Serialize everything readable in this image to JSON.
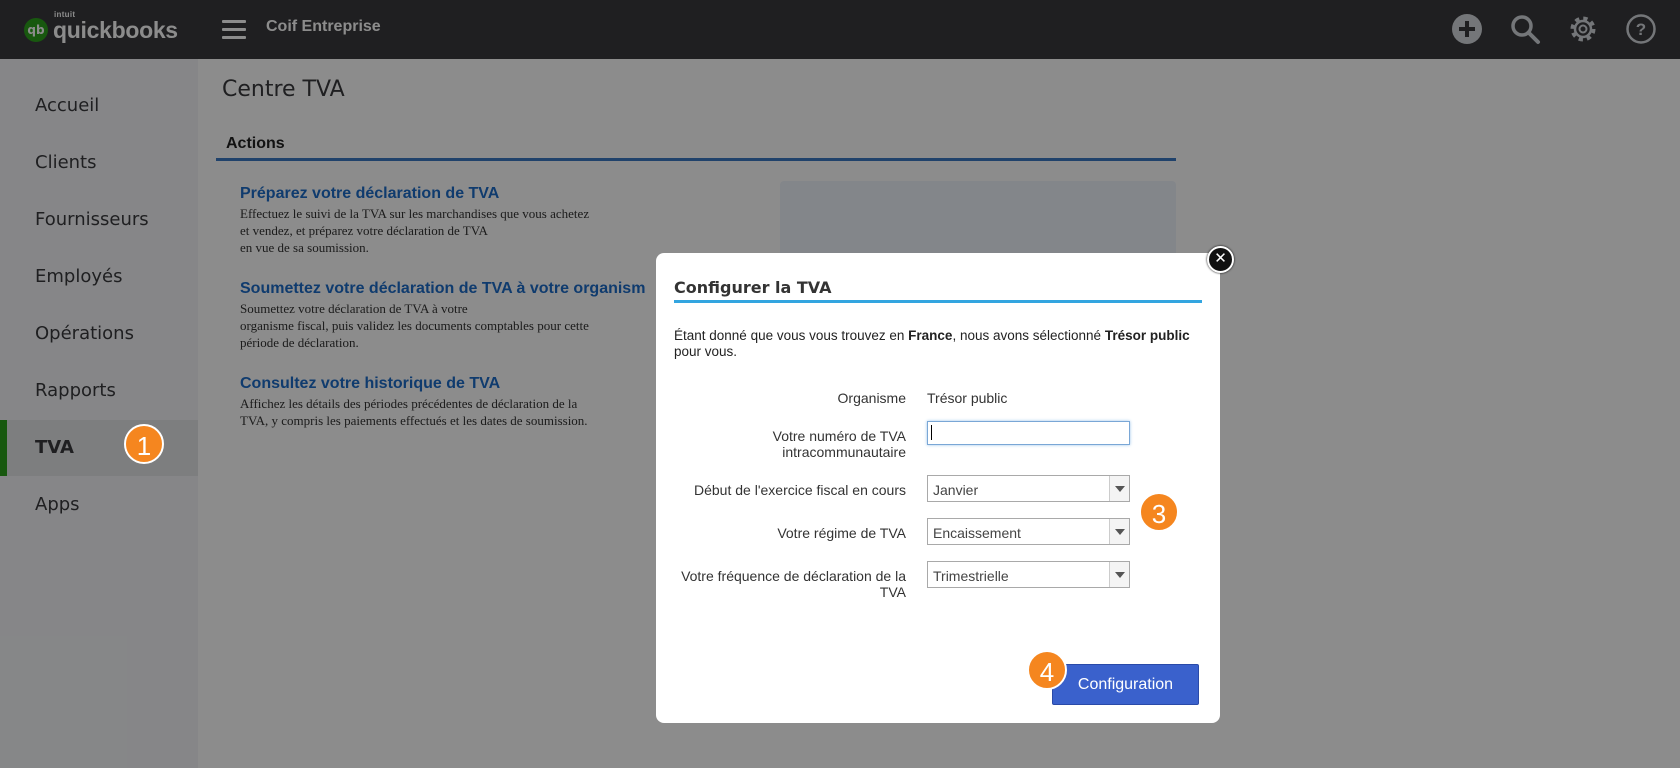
{
  "app": {
    "brand_small": "intuit",
    "brand_name": "quickbooks",
    "logo_mark": "qb",
    "company": "Coif Entreprise"
  },
  "sidebar": {
    "items": [
      {
        "label": "Accueil"
      },
      {
        "label": "Clients"
      },
      {
        "label": "Fournisseurs"
      },
      {
        "label": "Employés"
      },
      {
        "label": "Opérations"
      },
      {
        "label": "Rapports"
      },
      {
        "label": "TVA",
        "active": true
      },
      {
        "label": "Apps"
      }
    ]
  },
  "main": {
    "title": "Centre TVA",
    "section": "Actions",
    "actions": [
      {
        "title": "Préparez votre déclaration de TVA",
        "desc": [
          "Effectuez le suivi de la TVA sur les marchandises que vous achetez",
          "et vendez, et préparez votre déclaration de TVA",
          "en vue de sa soumission."
        ]
      },
      {
        "title": "Soumettez votre déclaration de TVA à votre organism",
        "desc": [
          "Soumettez votre déclaration de TVA à votre",
          "organisme fiscal, puis validez les documents comptables pour cette",
          "période de déclaration."
        ]
      },
      {
        "title": "Consultez votre historique de TVA",
        "desc": [
          "Affichez les détails des périodes précédentes de déclaration de la",
          "TVA, y compris les paiements effectués et les dates de soumission."
        ]
      }
    ]
  },
  "modal": {
    "title": "Configurer la TVA",
    "close_glyph": "✕",
    "intro": {
      "part1": "Étant donné que vous vous trouvez en ",
      "country": "France",
      "part2": ", nous avons sélectionné ",
      "agency": "Trésor public",
      "part3": " pour vous."
    },
    "fields": {
      "agency_label": "Organisme",
      "agency_value": "Trésor public",
      "vat_label": "Votre numéro de TVA intracommunautaire",
      "vat_value": "",
      "fiscal_label": "Début de l'exercice fiscal en cours",
      "fiscal_value": "Janvier",
      "regime_label": "Votre régime de TVA",
      "regime_value": "Encaissement",
      "frequency_label": "Votre fréquence de déclaration de la TVA",
      "frequency_value": "Trimestrielle"
    },
    "submit_label": "Configuration"
  },
  "badges": {
    "b1": "1",
    "b3": "3",
    "b4": "4"
  },
  "colors": {
    "topbar": "#393a3d",
    "accent_green": "#2ca01c",
    "link_blue": "#1d6cc8",
    "modal_rule": "#33a5e0",
    "button_blue": "#3a61cc",
    "badge_orange": "#f5861f"
  }
}
